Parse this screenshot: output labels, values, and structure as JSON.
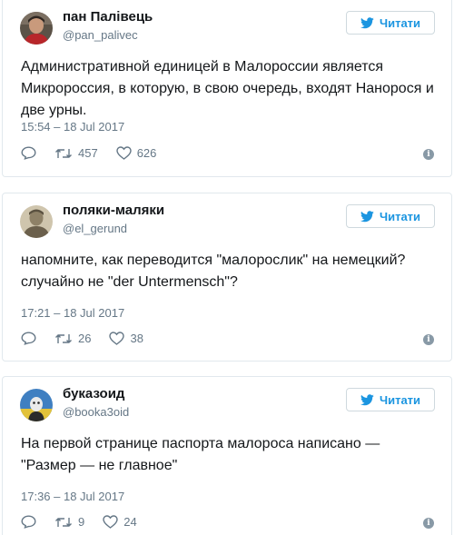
{
  "theme": {
    "accent": "#1b95e0",
    "text": "#14171a",
    "muted": "#657786",
    "border": "#e1e8ed"
  },
  "tweets": [
    {
      "name": "пан Палівець",
      "handle": "@pan_palivec",
      "follow_label": "Читати",
      "text": "Административной единицей в Малороссии является Микророссия, в которую, в свою очередь, входят Нанорося и две урны.",
      "time": "15:54 – 18 Jul 2017",
      "retweets": "457",
      "likes": "626",
      "avatar_icon": "portrait-red-shirt"
    },
    {
      "name": "поляки-маляки",
      "handle": "@el_gerund",
      "follow_label": "Читати",
      "text": "напомните, как переводится \"малорослик\" на немецкий? случайно не \"der Untermensch\"?",
      "time": "17:21 – 18 Jul 2017",
      "retweets": "26",
      "likes": "38",
      "avatar_icon": "vintage-sepia-portrait"
    },
    {
      "name": "буказоид",
      "handle": "@booka3oid",
      "follow_label": "Читати",
      "text": "На первой странице паспорта малороса написано — \"Размер — не главное\"",
      "time": "17:36 – 18 Jul 2017",
      "retweets": "9",
      "likes": "24",
      "avatar_icon": "cartoon-figure-blue-sky"
    }
  ]
}
